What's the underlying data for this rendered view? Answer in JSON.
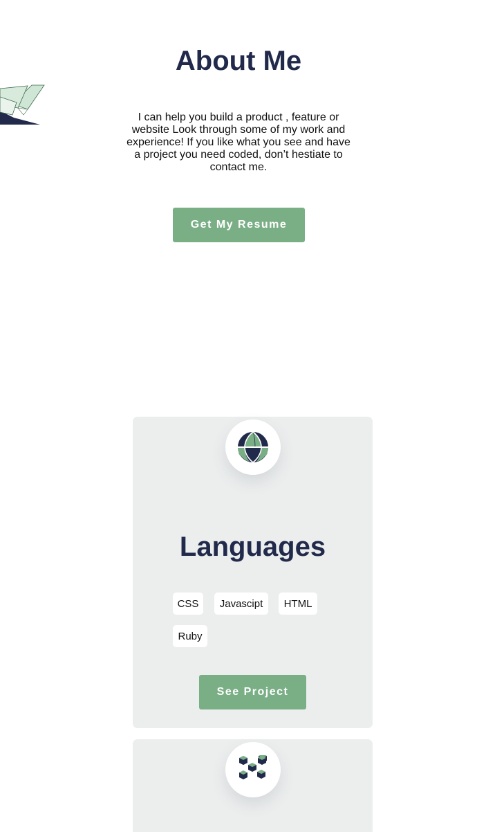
{
  "about": {
    "title": "About Me",
    "text": "I can help you build a product , feature or website Look through some of my work and experience! If you like what you see and have a project you need coded, don’t hestiate to contact me.",
    "resume_button": "Get My Resume",
    "decor_icon": "paper-crane-icon"
  },
  "cards": [
    {
      "icon": "globe-icon",
      "title": "Languages",
      "tags": [
        "CSS",
        "Javascipt",
        "HTML",
        "Ruby"
      ],
      "button": "See Project"
    },
    {
      "icon": "cubes-icon"
    }
  ],
  "colors": {
    "accent": "#7aaf86",
    "heading": "#222a4b",
    "card_bg": "#eceeee"
  }
}
